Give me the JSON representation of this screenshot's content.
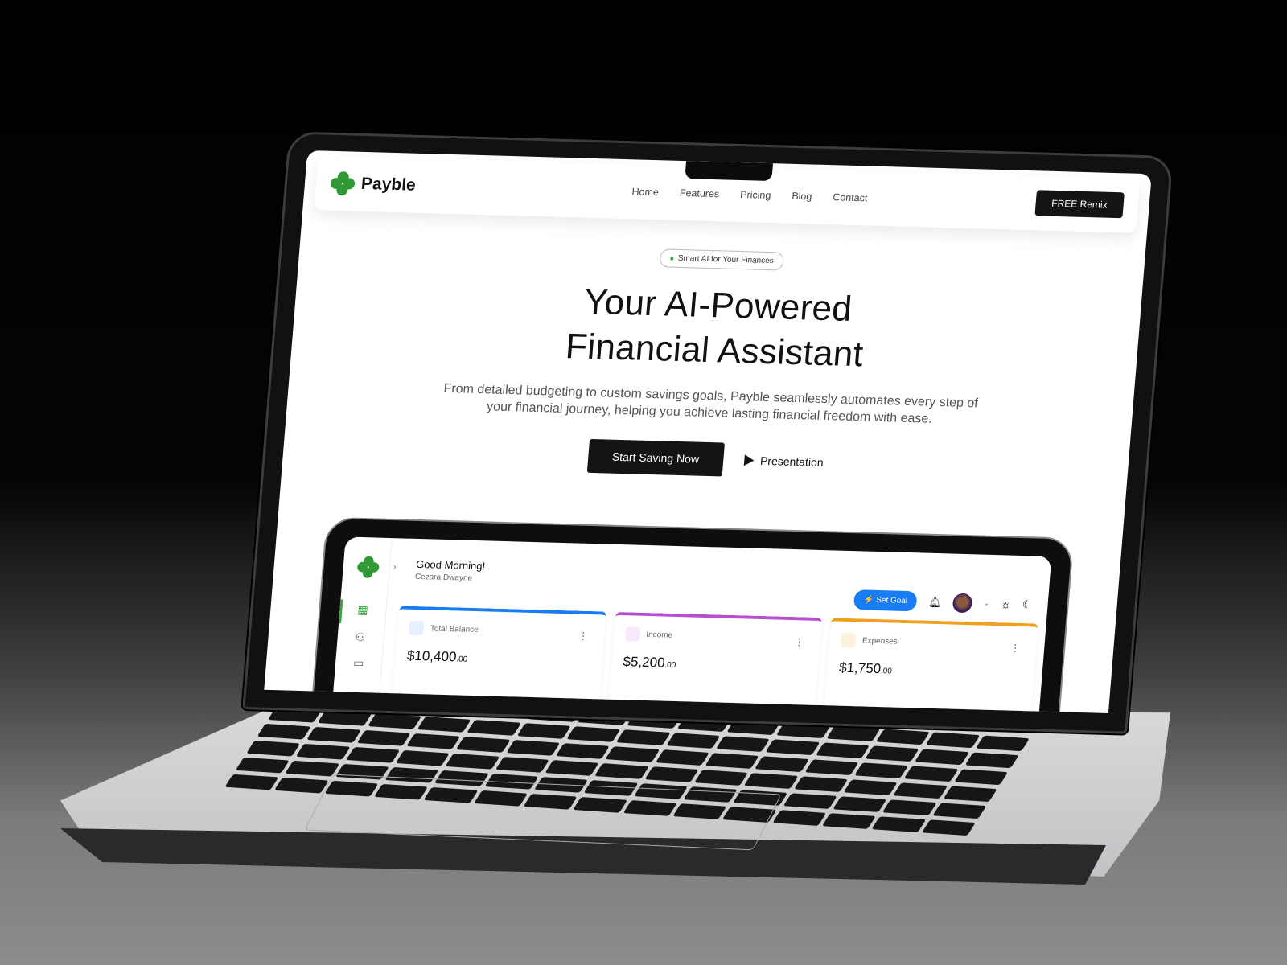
{
  "nav": {
    "brand": "Payble",
    "links": [
      "Home",
      "Features",
      "Pricing",
      "Blog",
      "Contact"
    ],
    "cta": "FREE Remix"
  },
  "hero": {
    "badge": "Smart AI for Your Finances",
    "title_line1": "Your AI-Powered",
    "title_line2": "Financial Assistant",
    "subtitle": "From detailed budgeting to custom savings goals, Payble seamlessly automates every step of your financial journey, helping you achieve lasting financial freedom with ease.",
    "primary_button": "Start Saving Now",
    "secondary_button": "Presentation"
  },
  "dashboard": {
    "greeting": "Good Morning!",
    "user": "Cezara Dwayne",
    "set_goal": "Set Goal",
    "cards": [
      {
        "label": "Total Balance",
        "amount": "$10,400",
        "cents": ".00",
        "color": "#1a7cf2",
        "icon": "wallet-icon"
      },
      {
        "label": "Income",
        "amount": "$5,200",
        "cents": ".00",
        "color": "#b84fd0",
        "icon": "coins-icon"
      },
      {
        "label": "Expenses",
        "amount": "$1,750",
        "cents": ".00",
        "color": "#f0a020",
        "icon": "hand-coins-icon"
      }
    ]
  },
  "colors": {
    "brand_green": "#2f9a35",
    "accent_blue": "#1a7cf2"
  }
}
